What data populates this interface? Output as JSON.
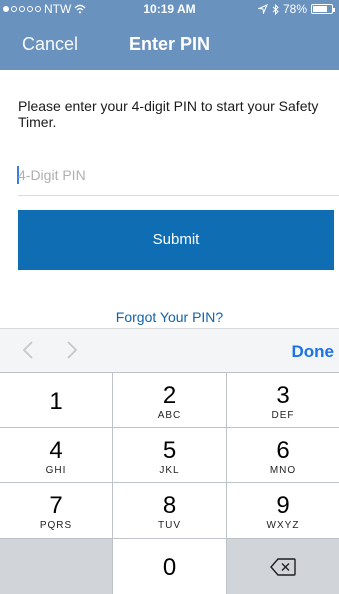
{
  "status_bar": {
    "carrier": "NTW",
    "signal_icon": "signal-dots-icon",
    "wifi_icon": "wifi-icon",
    "time": "10:19 AM",
    "location_icon": "location-arrow-icon",
    "bluetooth_icon": "bluetooth-icon",
    "battery_percent": "78%",
    "battery_level": 0.78
  },
  "nav": {
    "cancel_label": "Cancel",
    "title": "Enter PIN"
  },
  "form": {
    "instruction": "Please enter your 4-digit PIN to start your Safety Timer.",
    "pin_placeholder": "4-Digit PIN",
    "pin_value": "",
    "submit_label": "Submit",
    "forgot_label": "Forgot Your PIN?"
  },
  "accessory": {
    "prev_icon": "chevron-left-icon",
    "next_icon": "chevron-right-icon",
    "done_label": "Done"
  },
  "keypad": {
    "keys": [
      {
        "num": "1",
        "letters": ""
      },
      {
        "num": "2",
        "letters": "ABC"
      },
      {
        "num": "3",
        "letters": "DEF"
      },
      {
        "num": "4",
        "letters": "GHI"
      },
      {
        "num": "5",
        "letters": "JKL"
      },
      {
        "num": "6",
        "letters": "MNO"
      },
      {
        "num": "7",
        "letters": "PQRS"
      },
      {
        "num": "8",
        "letters": "TUV"
      },
      {
        "num": "9",
        "letters": "WXYZ"
      },
      {
        "num": "0",
        "letters": ""
      }
    ],
    "backspace_icon": "backspace-icon"
  },
  "colors": {
    "header_bg": "#6a92bf",
    "submit_bg": "#0f6db4",
    "link": "#1163ab",
    "done": "#1a73e8"
  }
}
